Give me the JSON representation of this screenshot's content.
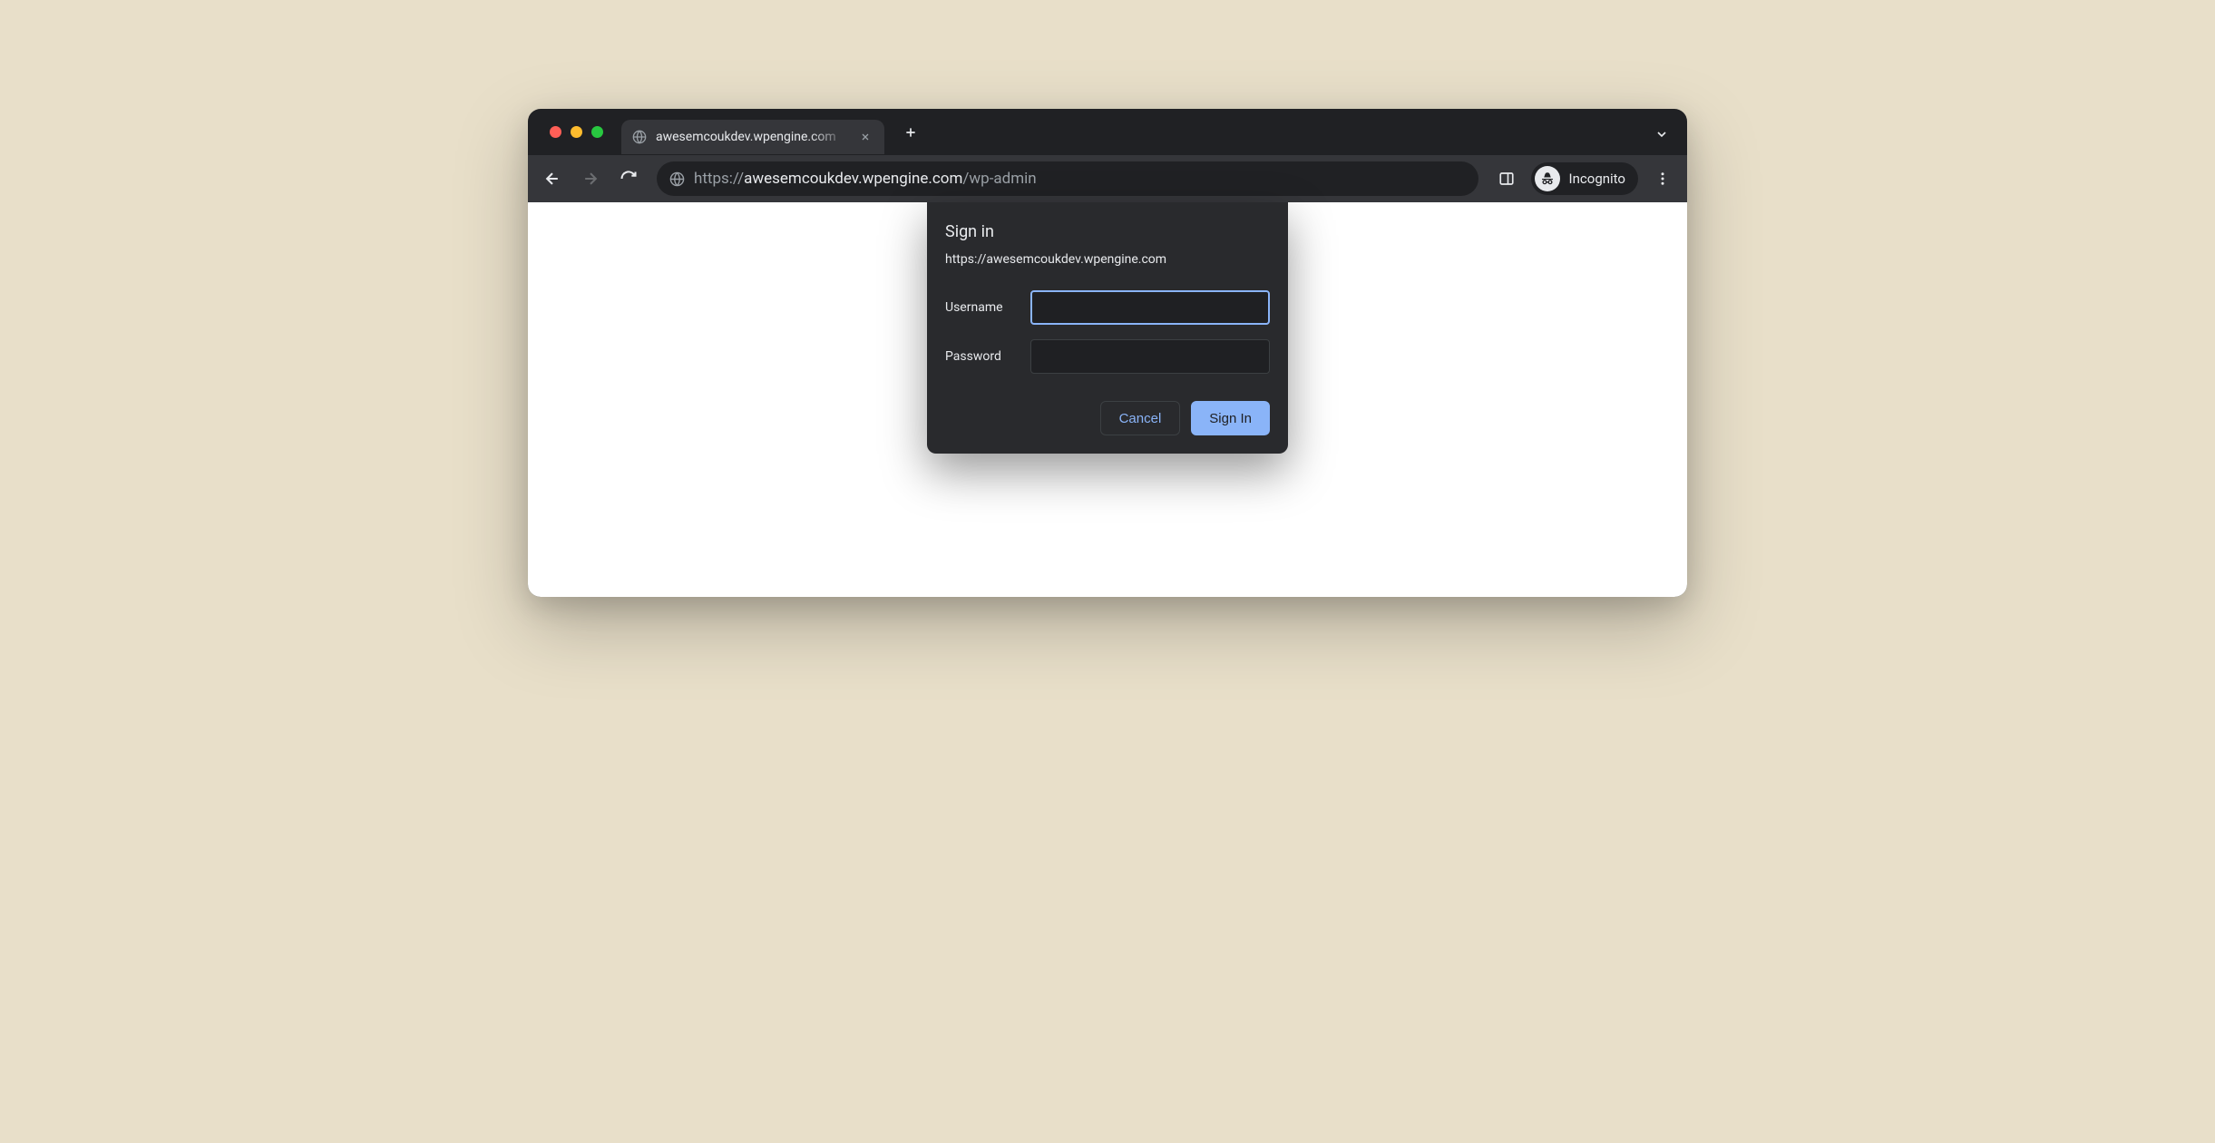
{
  "tab": {
    "title": "awesemcoukdev.wpengine.com"
  },
  "url": {
    "scheme": "https://",
    "host": "awesemcoukdev.wpengine.com",
    "path": "/wp-admin"
  },
  "incognito_label": "Incognito",
  "auth": {
    "title": "Sign in",
    "host": "https://awesemcoukdev.wpengine.com",
    "username_label": "Username",
    "username_value": "",
    "password_label": "Password",
    "password_value": "",
    "cancel_label": "Cancel",
    "signin_label": "Sign In"
  }
}
